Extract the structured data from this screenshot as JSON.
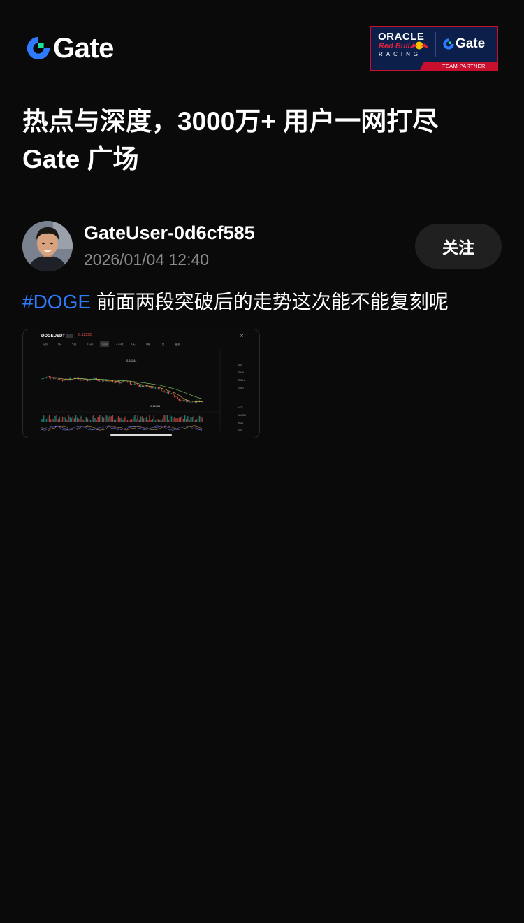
{
  "header": {
    "brand": "Gate",
    "partner_badge": {
      "line1": "ORACLE",
      "line2": "Red Bull",
      "line3": "RACING",
      "brand": "Gate",
      "tag": "TEAM PARTNER"
    }
  },
  "headline": {
    "line1": "热点与深度，3000万+ 用户一网打尽",
    "line2": "Gate 广场"
  },
  "post": {
    "username": "GateUser-0d6cf585",
    "timestamp": "2026/01/04 12:40",
    "follow_label": "关注",
    "hashtag": "#DOGE",
    "text": " 前面两段突破后的走势这次能不能复刻呢"
  },
  "chart_thumbnail": {
    "symbol": "DOGEUSDT",
    "price": "0.12235",
    "high_label": "0.15244",
    "low_label": "0.11884",
    "intervals": [
      "分时",
      "1分",
      "5分",
      "15分",
      "1小时",
      "4小时",
      "1天",
      "1周",
      "1月",
      "更多"
    ],
    "right_labels": [
      "MA",
      "EMA",
      "BOLL",
      "SAR",
      "VOL",
      "MACD",
      "KDJ",
      "RSI"
    ]
  },
  "colors": {
    "background": "#0a0a0a",
    "hashtag": "#2f7bff",
    "secondary_text": "#8a8a8a",
    "follow_button": "#202020",
    "up": "#26a69a",
    "down": "#ef5350"
  }
}
